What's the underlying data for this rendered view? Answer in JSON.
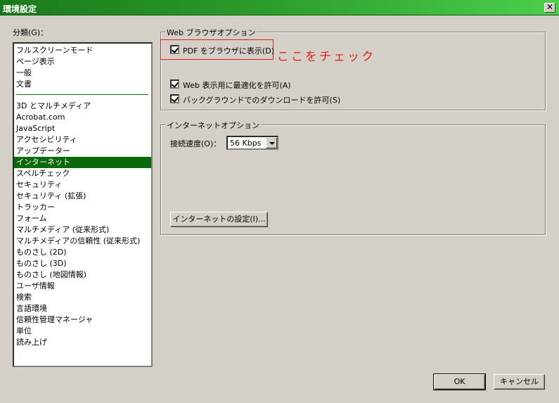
{
  "window": {
    "title": "環境設定",
    "close_glyph": "✕"
  },
  "categories": {
    "label": "分類(G)：",
    "items_top": [
      "フルスクリーンモード",
      "ページ表示",
      "一般",
      "文書"
    ],
    "items": [
      "3D とマルチメディア",
      "Acrobat.com",
      "JavaScript",
      "アクセシビリティ",
      "アップデーター",
      "インターネット",
      "スペルチェック",
      "セキュリティ",
      "セキュリティ (拡張)",
      "トラッカー",
      "フォーム",
      "マルチメディア (従来形式)",
      "マルチメディアの信頼性 (従来形式)",
      "ものさし (2D)",
      "ものさし (3D)",
      "ものさし (地図情報)",
      "ユーザ情報",
      "検索",
      "言語環境",
      "信頼性管理マネージャ",
      "単位",
      "読み上げ"
    ],
    "selected": "インターネット"
  },
  "web_browser_options": {
    "legend": "Web ブラウザオプション",
    "display_pdf_in_browser": {
      "label": "PDF をブラウザに表示(D)",
      "checked": true
    },
    "allow_fast_web_view": {
      "label": "Web 表示用に最適化を許可(A)",
      "checked": true
    },
    "allow_background_download": {
      "label": "バックグラウンドでのダウンロードを許可(S)",
      "checked": true
    }
  },
  "annotation": {
    "text": "ここをチェック",
    "color": "#e02020"
  },
  "internet_options": {
    "legend": "インターネットオプション",
    "connection_speed_label": "接続速度(O)：",
    "connection_speed_value": "56 Kbps",
    "internet_settings_button": "インターネットの設定(I)..."
  },
  "buttons": {
    "ok": "OK",
    "cancel": "キャンセル"
  },
  "colors": {
    "titlebar_start": "#1a7a1a",
    "titlebar_end": "#4cd04c",
    "selection": "#0a6a0a",
    "dialog_bg": "#d4d0c8"
  }
}
